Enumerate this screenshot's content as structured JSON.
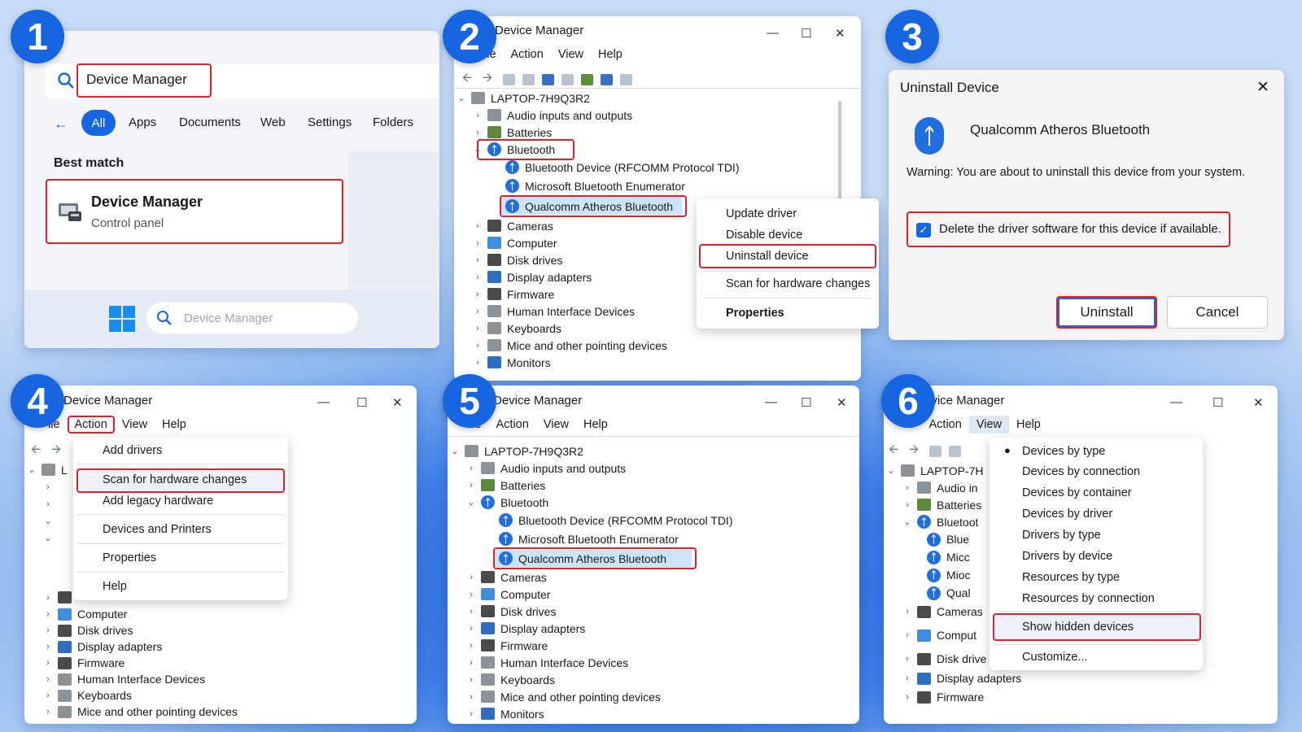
{
  "steps": [
    "1",
    "2",
    "3",
    "4",
    "5",
    "6"
  ],
  "start_search": {
    "query": "Device Manager",
    "filters": [
      "All",
      "Apps",
      "Documents",
      "Web",
      "Settings",
      "Folders"
    ],
    "best_match_heading": "Best match",
    "result_title": "Device Manager",
    "result_subtitle": "Control panel",
    "taskbar_search_placeholder": "Device Manager"
  },
  "window": {
    "title": "Device Manager",
    "menu": [
      "File",
      "Action",
      "View",
      "Help"
    ],
    "computer": "LAPTOP-7H9Q3R2"
  },
  "window_title_partial": "evice Manager",
  "menu_partial": {
    "file": "ile",
    "file4": "ile"
  },
  "tree": {
    "audio": "Audio inputs and outputs",
    "batteries": "Batteries",
    "bluetooth": "Bluetooth",
    "bt1": "Bluetooth Device (RFCOMM Protocol TDI)",
    "bt2": "Microsoft Bluetooth Enumerator",
    "bt3": "Qualcomm Atheros Bluetooth",
    "cameras": "Cameras",
    "computer": "Computer",
    "disk": "Disk drives",
    "display": "Display adapters",
    "firmware": "Firmware",
    "hid": "Human Interface Devices",
    "keyboards": "Keyboards",
    "mice": "Mice and other pointing devices",
    "monitors": "Monitors"
  },
  "tree_partial": {
    "laptop": "LAPTOP-7H",
    "audio": "Audio in",
    "batteries": "Batteries",
    "bluetooth": "Bluetoot",
    "bt1": "Blue",
    "bt2": "Micc",
    "bt3": "Mioc",
    "bt4": "Qual",
    "computer": "Comput",
    "disk": "Disk drive",
    "monitors": "Monitors",
    "laptop4": "L"
  },
  "context_menu": [
    "Update driver",
    "Disable device",
    "Uninstall device",
    "Scan for hardware changes",
    "Properties"
  ],
  "uninstall_dialog": {
    "title": "Uninstall Device",
    "device": "Qualcomm Atheros Bluetooth",
    "warning": "Warning: You are about to uninstall this device from your system.",
    "checkbox_label": "Delete the driver software for this device if available.",
    "checked": true,
    "uninstall_label": "Uninstall",
    "cancel_label": "Cancel"
  },
  "action_menu": [
    "Add drivers",
    "Scan for hardware changes",
    "Add legacy hardware",
    "Devices and Printers",
    "Properties",
    "Help"
  ],
  "view_menu": [
    "Devices by type",
    "Devices by connection",
    "Devices by container",
    "Devices by driver",
    "Drivers by type",
    "Drivers by device",
    "Resources by type",
    "Resources by connection",
    "Show hidden devices",
    "Customize..."
  ],
  "icons": {
    "search": "search-icon",
    "back": "back-arrow-icon",
    "close": "close-icon",
    "bluetooth": "bluetooth-icon",
    "windows": "windows-logo-icon"
  },
  "colors": {
    "highlight_border": "#e0202a",
    "accent": "#1566e0",
    "selection": "#cce4f7"
  }
}
